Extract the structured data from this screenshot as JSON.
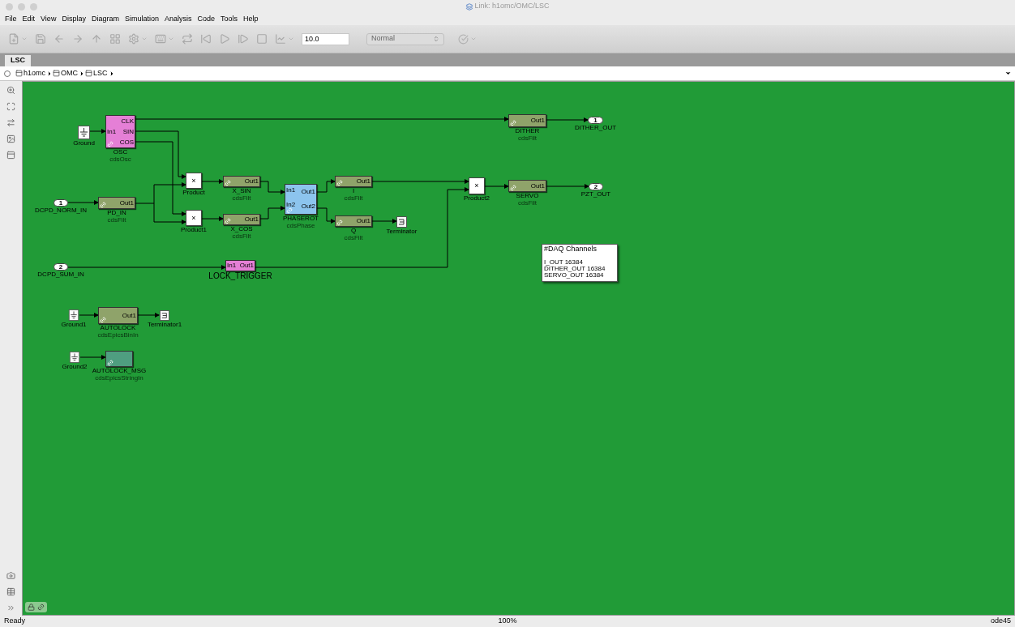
{
  "window": {
    "title": "Link: h1omc/OMC/LSC"
  },
  "menu": [
    "File",
    "Edit",
    "View",
    "Display",
    "Diagram",
    "Simulation",
    "Analysis",
    "Code",
    "Tools",
    "Help"
  ],
  "toolbar": {
    "stop_time": "10.0",
    "mode": "Normal"
  },
  "tabs": [
    {
      "label": "LSC",
      "selected": true
    }
  ],
  "breadcrumb": [
    "h1omc",
    "OMC",
    "LSC"
  ],
  "diagram": {
    "blocks": [
      {
        "kind": "ground",
        "name": "Ground"
      },
      {
        "kind": "subsystem",
        "name": "OSC",
        "library": "cdsOsc",
        "color": "#e57fd6",
        "linked": true,
        "in_ports": [
          "In1"
        ],
        "out_ports": [
          "CLK",
          "SIN",
          "COS"
        ]
      },
      {
        "kind": "subsystem",
        "name": "DITHER",
        "library": "cdsFilt",
        "color": "#8fa36a",
        "linked": true,
        "out_ports": [
          "Out1"
        ]
      },
      {
        "kind": "outport",
        "name": "DITHER_OUT",
        "number": "1"
      },
      {
        "kind": "inport",
        "name": "DCPD_NORM_IN",
        "number": "1"
      },
      {
        "kind": "subsystem",
        "name": "PD_IN",
        "library": "cdsFilt",
        "color": "#8fa36a",
        "linked": true,
        "out_ports": [
          "Out1"
        ]
      },
      {
        "kind": "product",
        "name": "Product",
        "symbol": "×"
      },
      {
        "kind": "product",
        "name": "Product1",
        "symbol": "×"
      },
      {
        "kind": "subsystem",
        "name": "X_SIN",
        "library": "cdsFilt",
        "color": "#8fa36a",
        "linked": true,
        "out_ports": [
          "Out1"
        ]
      },
      {
        "kind": "subsystem",
        "name": "X_COS",
        "library": "cdsFilt",
        "color": "#8fa36a",
        "linked": true,
        "out_ports": [
          "Out1"
        ]
      },
      {
        "kind": "subsystem",
        "name": "PHASEROT",
        "library": "cdsPhase",
        "color": "#8cc4ee",
        "linked": true,
        "in_ports": [
          "In1",
          "In2"
        ],
        "out_ports": [
          "Out1",
          "Out2"
        ]
      },
      {
        "kind": "subsystem",
        "name": "I",
        "library": "cdsFilt",
        "color": "#8fa36a",
        "linked": true,
        "out_ports": [
          "Out1"
        ]
      },
      {
        "kind": "subsystem",
        "name": "Q",
        "library": "cdsFilt",
        "color": "#8fa36a",
        "linked": true,
        "out_ports": [
          "Out1"
        ]
      },
      {
        "kind": "terminator",
        "name": "Terminator"
      },
      {
        "kind": "product",
        "name": "Product2",
        "symbol": "×"
      },
      {
        "kind": "subsystem",
        "name": "SERVO",
        "library": "cdsFilt",
        "color": "#8fa36a",
        "linked": true,
        "out_ports": [
          "Out1"
        ]
      },
      {
        "kind": "outport",
        "name": "PZT_OUT",
        "number": "2"
      },
      {
        "kind": "inport",
        "name": "DCPD_SUM_IN",
        "number": "2"
      },
      {
        "kind": "subsystem",
        "name": "LOCK_TRIGGER",
        "color": "#e57fd6",
        "linked": false,
        "in_ports": [
          "In1"
        ],
        "out_ports": [
          "Out1"
        ]
      },
      {
        "kind": "ground",
        "name": "Ground1"
      },
      {
        "kind": "subsystem",
        "name": "AUTOLOCK",
        "library": "cdsEpicsBinIn",
        "color": "#8fa36a",
        "linked": true,
        "out_ports": [
          "Out1"
        ]
      },
      {
        "kind": "terminator",
        "name": "Terminator1"
      },
      {
        "kind": "ground",
        "name": "Ground2"
      },
      {
        "kind": "subsystem",
        "name": "AUTOLOCK_MSG",
        "library": "cdsEpicsStringIn",
        "color": "#4f9e80",
        "linked": true
      }
    ],
    "note": {
      "title": "#DAQ Channels",
      "lines": [
        "I_OUT 16384",
        "DITHER_OUT 16384",
        "SERVO_OUT 16384"
      ]
    }
  },
  "status_bar": {
    "state": "Ready",
    "zoom": "100%",
    "solver": "ode45"
  }
}
